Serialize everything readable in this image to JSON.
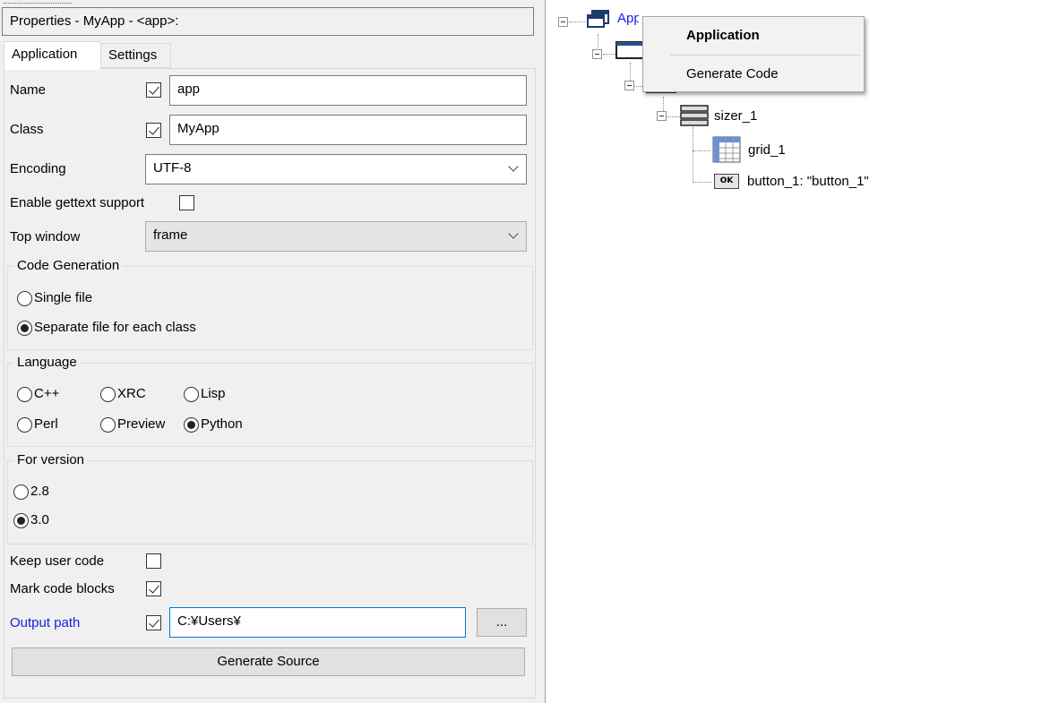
{
  "window": {
    "title": "Properties - MyApp - <app>:"
  },
  "tabs": [
    {
      "label": "Application",
      "selected": true
    },
    {
      "label": "Settings",
      "selected": false
    }
  ],
  "fields": {
    "name": {
      "label": "Name",
      "checked": true,
      "value": "app"
    },
    "class": {
      "label": "Class",
      "checked": true,
      "value": "MyApp"
    },
    "encoding": {
      "label": "Encoding",
      "value": "UTF-8"
    },
    "gettext": {
      "label": "Enable gettext support",
      "checked": false
    },
    "top_window": {
      "label": "Top window",
      "value": "frame"
    }
  },
  "code_generation": {
    "label": "Code Generation",
    "options": [
      {
        "label": "Single file",
        "selected": false
      },
      {
        "label": "Separate file for each class",
        "selected": true
      }
    ]
  },
  "language": {
    "label": "Language",
    "options": [
      {
        "label": "C++",
        "selected": false
      },
      {
        "label": "XRC",
        "selected": false
      },
      {
        "label": "Lisp",
        "selected": false
      },
      {
        "label": "Perl",
        "selected": false
      },
      {
        "label": "Preview",
        "selected": false
      },
      {
        "label": "Python",
        "selected": true
      }
    ]
  },
  "for_version": {
    "label": "For version",
    "options": [
      {
        "label": "2.8",
        "selected": false
      },
      {
        "label": "3.0",
        "selected": true
      }
    ]
  },
  "keep_user_code": {
    "label": "Keep user code",
    "checked": false
  },
  "mark_code_blocks": {
    "label": "Mark code blocks",
    "checked": true
  },
  "output_path": {
    "label": "Output path",
    "checked": true,
    "value": "C:¥Users¥",
    "browse_label": "..."
  },
  "generate_button": {
    "label": "Generate Source"
  },
  "tree": {
    "root": "Application",
    "sizer": "sizer_1",
    "grid": "grid_1",
    "button": "button_1: \"button_1\"",
    "ok_badge": "OK"
  },
  "context_menu": {
    "items": [
      {
        "label": "Application",
        "bold": true
      },
      {
        "label": "Generate Code",
        "bold": false
      }
    ]
  },
  "colors": {
    "link_blue": "#1a1ae6",
    "panel_bg": "#f0f0f0",
    "tree_bg": "#ffffff"
  }
}
